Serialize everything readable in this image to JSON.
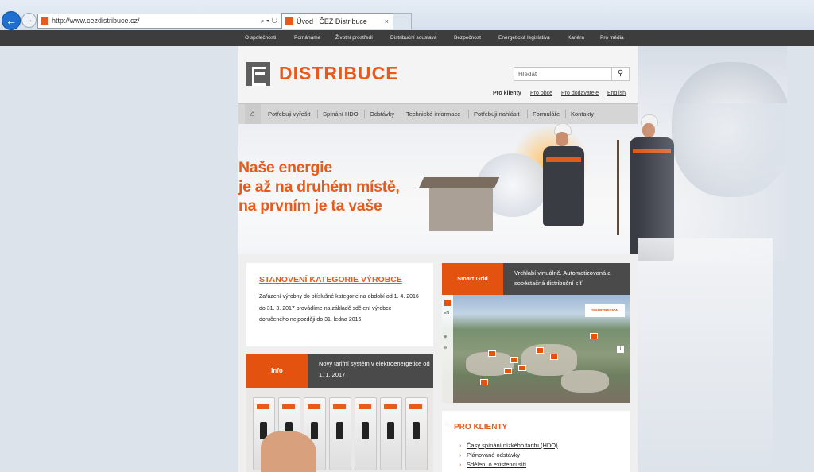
{
  "browser": {
    "url": "http://www.cezdistribuce.cz/",
    "tab_title": "Úvod | ČEZ Distribuce",
    "tab_close": "×",
    "tools": "⌕ ▾ ↻"
  },
  "topnav": {
    "items": [
      "O společnosti",
      "Pomáháme",
      "Životní prostředí",
      "Distribuční soustava",
      "Bezpečnost",
      "Energetická legislativa",
      "Kariéra",
      "Pro média"
    ]
  },
  "header": {
    "brand": "DISTRIBUCE",
    "search_placeholder": "Hledat",
    "search_icon": "search-icon",
    "audiences": [
      "Pro klienty",
      "Pro obce",
      "Pro dodavatele",
      "English"
    ]
  },
  "mainnav": {
    "home_icon": "home-icon",
    "items": [
      "Potřebuji vyřešit",
      "Spínání HDO",
      "Odstávky",
      "Technické informace",
      "Potřebuji nahlásit",
      "Formuláře",
      "Kontakty"
    ]
  },
  "hero": {
    "slogan": [
      "Naše energie",
      "je až na druhém místě,",
      "na prvním je ta vaše"
    ]
  },
  "card_vyrobce": {
    "title": "STANOVENÍ KATEGORIE VÝROBCE",
    "body": "Zařazení výrobny do příslušné kategorie na období od 1. 4. 2016 do 31. 3. 2017 provádíme na základě sdělení výrobce doručeného nejpozději do 31. ledna 2016."
  },
  "card_info": {
    "label": "Info",
    "text": "Nový tarifní systém v elektroenergetice od 1. 1. 2017"
  },
  "card_smart": {
    "label": "Smart Grid",
    "text": "Vrchlabí virtuálně. Automatizovaná a soběstačná distribuční síť",
    "badge": "SMARTREGION",
    "side_labels": [
      "EN",
      "⊕",
      "⊖"
    ],
    "info_glyph": "i"
  },
  "pro_klienty": {
    "title": "PRO KLIENTY",
    "links": [
      "Časy spínání nízkého tarifu (HDO)",
      "Plánované odstávky",
      "Sdělení o existenci sítí"
    ]
  },
  "colors": {
    "accent": "#e85a1b",
    "topnav_bg": "#3d3d3d",
    "mainnav_bg": "#d5d5d5"
  }
}
